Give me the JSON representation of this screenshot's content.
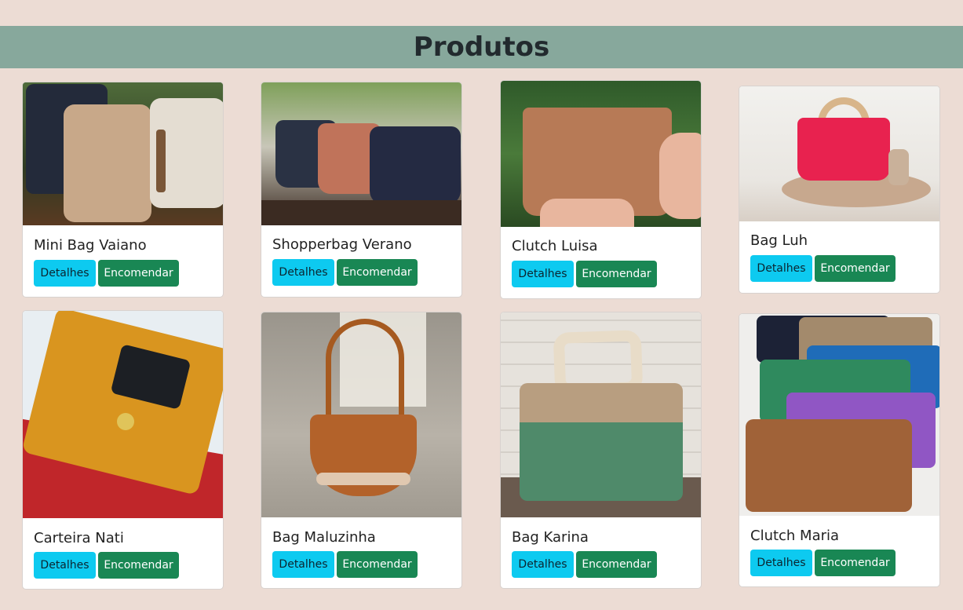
{
  "header": {
    "title": "Produtos"
  },
  "products": [
    {
      "name": "Mini Bag Vaiano",
      "details_label": "Detalhes",
      "order_label": "Encomendar"
    },
    {
      "name": "Shopperbag Verano",
      "details_label": "Detalhes",
      "order_label": "Encomendar"
    },
    {
      "name": "Clutch Luisa",
      "details_label": "Detalhes",
      "order_label": "Encomendar"
    },
    {
      "name": "Bag Luh",
      "details_label": "Detalhes",
      "order_label": "Encomendar"
    },
    {
      "name": "Carteira Nati",
      "details_label": "Detalhes",
      "order_label": "Encomendar"
    },
    {
      "name": "Bag Maluzinha",
      "details_label": "Detalhes",
      "order_label": "Encomendar"
    },
    {
      "name": "Bag Karina",
      "details_label": "Detalhes",
      "order_label": "Encomendar"
    },
    {
      "name": "Clutch Maria",
      "details_label": "Detalhes",
      "order_label": "Encomendar"
    }
  ],
  "colors": {
    "background": "#ecdcd4",
    "header": "#87a89c",
    "details_button": "#0dcaf0",
    "order_button": "#198754"
  }
}
